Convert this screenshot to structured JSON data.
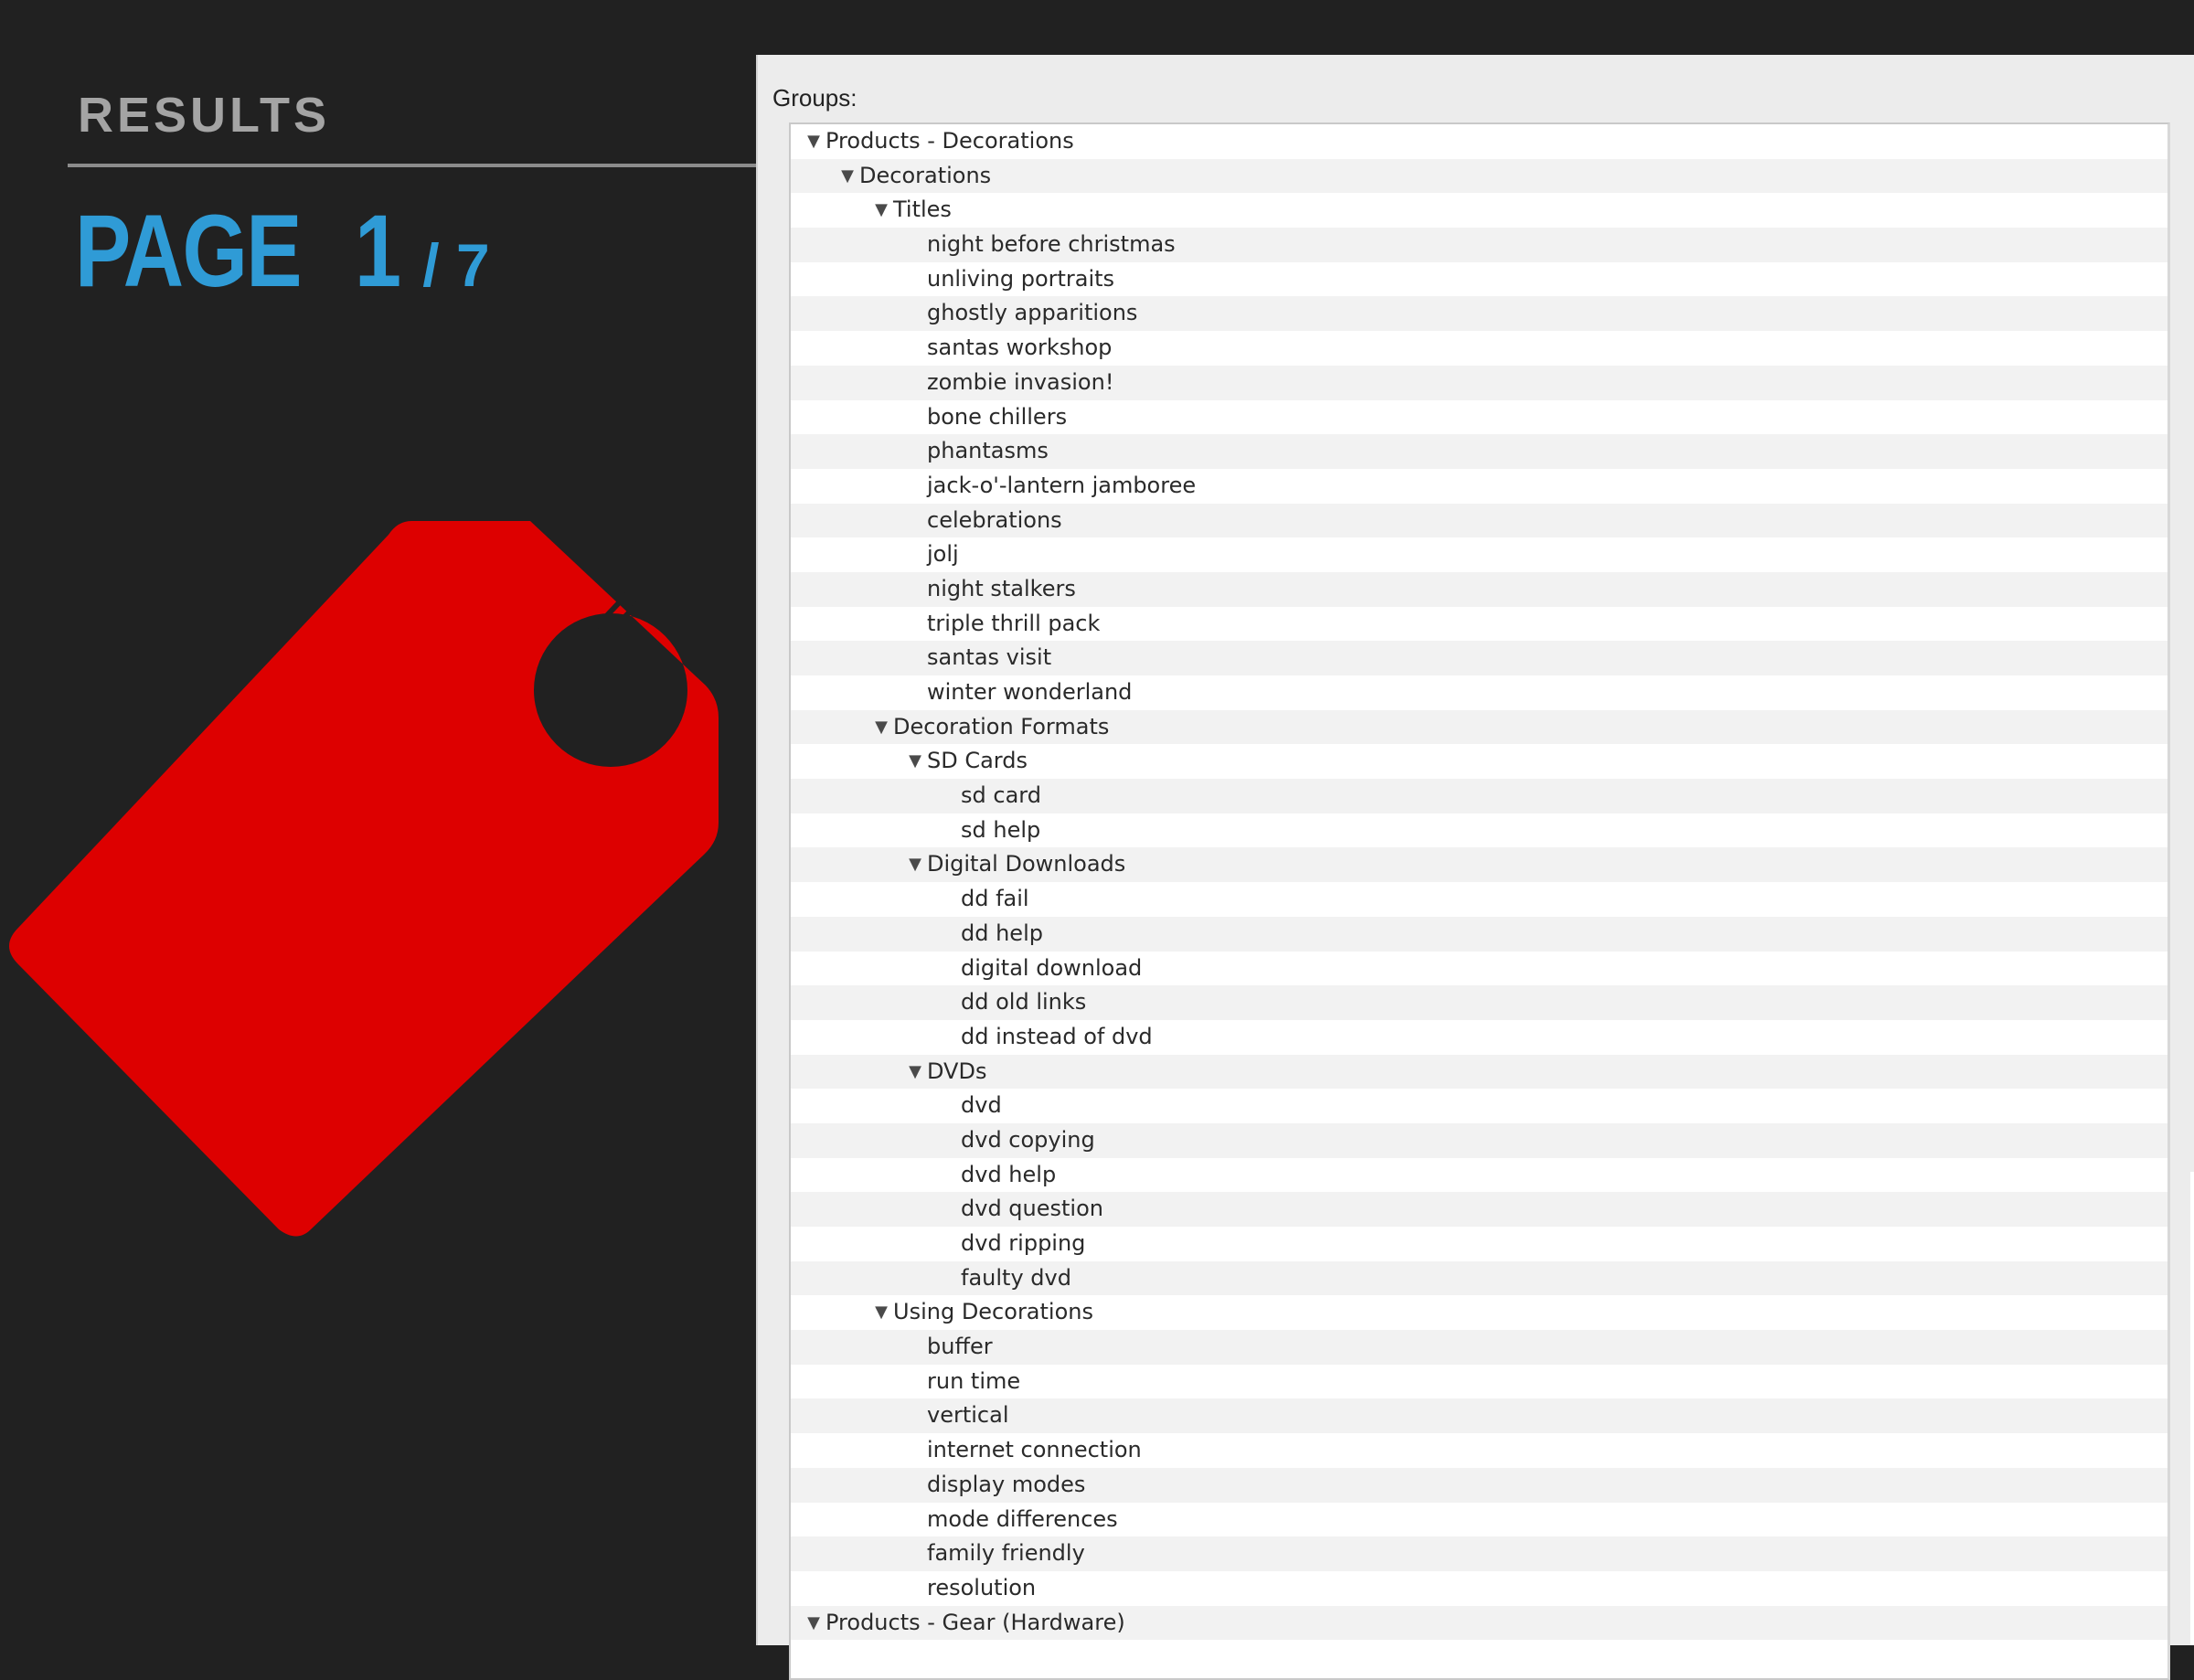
{
  "slide": {
    "heading": "RESULTS",
    "page_word": "PAGE",
    "page_current": "1",
    "page_total": "/ 7",
    "accent_color": "#2f9bd6",
    "tag_color": "#dd0000",
    "tag_icon": "price-tag-icon"
  },
  "panel": {
    "groups_label": "Groups:",
    "rows": [
      {
        "label": "Products - Decorations",
        "level": 0,
        "expanded": true
      },
      {
        "label": "Decorations",
        "level": 1,
        "expanded": true
      },
      {
        "label": "Titles",
        "level": 2,
        "expanded": true
      },
      {
        "label": "night before christmas",
        "level": 3
      },
      {
        "label": "unliving portraits",
        "level": 3
      },
      {
        "label": "ghostly apparitions",
        "level": 3
      },
      {
        "label": "santas workshop",
        "level": 3
      },
      {
        "label": "zombie invasion!",
        "level": 3
      },
      {
        "label": "bone chillers",
        "level": 3
      },
      {
        "label": "phantasms",
        "level": 3
      },
      {
        "label": "jack-o'-lantern jamboree",
        "level": 3
      },
      {
        "label": "celebrations",
        "level": 3
      },
      {
        "label": "jolj",
        "level": 3
      },
      {
        "label": "night stalkers",
        "level": 3
      },
      {
        "label": "triple thrill pack",
        "level": 3
      },
      {
        "label": "santas visit",
        "level": 3
      },
      {
        "label": "winter wonderland",
        "level": 3
      },
      {
        "label": "Decoration Formats",
        "level": 2,
        "expanded": true
      },
      {
        "label": "SD Cards",
        "level": 3,
        "expanded": true
      },
      {
        "label": "sd card",
        "level": 4
      },
      {
        "label": "sd help",
        "level": 4
      },
      {
        "label": "Digital Downloads",
        "level": 3,
        "expanded": true
      },
      {
        "label": "dd fail",
        "level": 4
      },
      {
        "label": "dd help",
        "level": 4
      },
      {
        "label": "digital download",
        "level": 4
      },
      {
        "label": "dd old links",
        "level": 4
      },
      {
        "label": "dd instead of dvd",
        "level": 4
      },
      {
        "label": "DVDs",
        "level": 3,
        "expanded": true
      },
      {
        "label": "dvd",
        "level": 4
      },
      {
        "label": "dvd copying",
        "level": 4
      },
      {
        "label": "dvd help",
        "level": 4
      },
      {
        "label": "dvd question",
        "level": 4
      },
      {
        "label": "dvd ripping",
        "level": 4
      },
      {
        "label": "faulty dvd",
        "level": 4
      },
      {
        "label": "Using Decorations",
        "level": 2,
        "expanded": true
      },
      {
        "label": "buffer",
        "level": 3
      },
      {
        "label": "run time",
        "level": 3
      },
      {
        "label": "vertical",
        "level": 3
      },
      {
        "label": "internet connection",
        "level": 3
      },
      {
        "label": "display modes",
        "level": 3
      },
      {
        "label": "mode differences",
        "level": 3
      },
      {
        "label": "family friendly",
        "level": 3
      },
      {
        "label": "resolution",
        "level": 3
      },
      {
        "label": "Products - Gear (Hardware)",
        "level": 0,
        "expanded": true
      }
    ]
  }
}
